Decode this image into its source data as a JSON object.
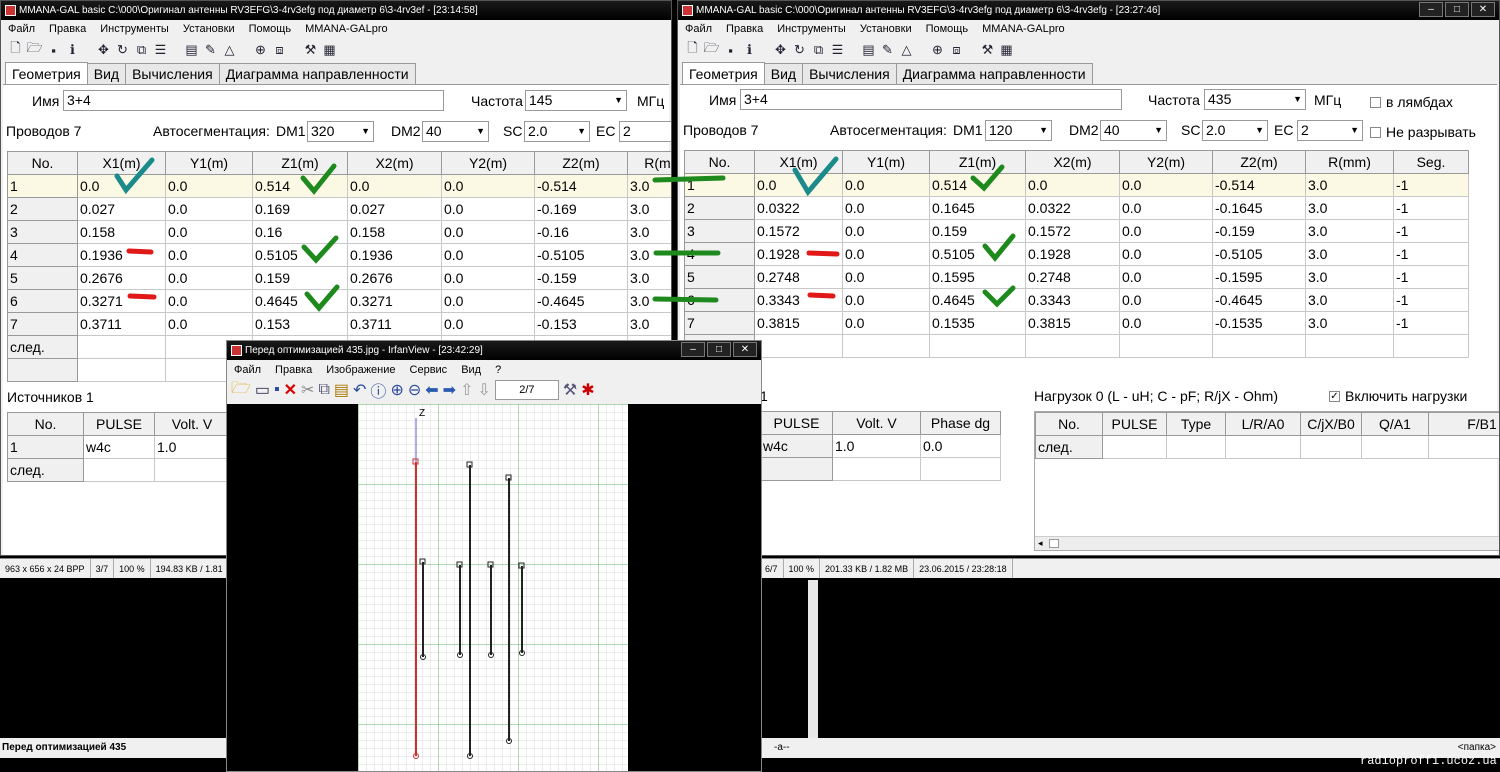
{
  "left_window": {
    "title": "MMANA-GAL basic  C:\\000\\Оригинал антенны RV3EFG\\3-4rv3efg под диаметр 6\\3-4rv3ef - [23:14:58]",
    "menu": [
      "Файл",
      "Правка",
      "Инструменты",
      "Установки",
      "Помощь",
      "MMANA-GALpro"
    ],
    "tabs": [
      "Геометрия",
      "Вид",
      "Вычисления",
      "Диаграмма направленности"
    ],
    "name_label": "Имя",
    "name_value": "3+4",
    "freq_label": "Частота",
    "freq_value": "145",
    "freq_unit": "МГц",
    "wires_label": "Проводов 7",
    "autoseg_label": "Автосегментация:",
    "dm1_label": "DM1",
    "dm1_value": "320",
    "dm2_label": "DM2",
    "dm2_value": "40",
    "sc_label": "SC",
    "sc_value": "2.0",
    "ec_label": "EC",
    "ec_value": "2",
    "columns": [
      "No.",
      "X1(m)",
      "Y1(m)",
      "Z1(m)",
      "X2(m)",
      "Y2(m)",
      "Z2(m)",
      "R(m"
    ],
    "rows": [
      [
        "1",
        "0.0",
        "0.0",
        "0.514",
        "0.0",
        "0.0",
        "-0.514",
        "3.0"
      ],
      [
        "2",
        "0.027",
        "0.0",
        "0.169",
        "0.027",
        "0.0",
        "-0.169",
        "3.0"
      ],
      [
        "3",
        "0.158",
        "0.0",
        "0.16",
        "0.158",
        "0.0",
        "-0.16",
        "3.0"
      ],
      [
        "4",
        "0.1936",
        "0.0",
        "0.5105",
        "0.1936",
        "0.0",
        "-0.5105",
        "3.0"
      ],
      [
        "5",
        "0.2676",
        "0.0",
        "0.159",
        "0.2676",
        "0.0",
        "-0.159",
        "3.0"
      ],
      [
        "6",
        "0.3271",
        "0.0",
        "0.4645",
        "0.3271",
        "0.0",
        "-0.4645",
        "3.0"
      ],
      [
        "7",
        "0.3711",
        "0.0",
        "0.153",
        "0.3711",
        "0.0",
        "-0.153",
        "3.0"
      ]
    ],
    "next_label": "след.",
    "sources_label": "Источников 1",
    "src_columns": [
      "No.",
      "PULSE",
      "Volt. V"
    ],
    "src_rows": [
      [
        "1",
        "w4c",
        "1.0"
      ]
    ],
    "status": [
      "963 x 656 x 24 BPP",
      "3/7",
      "100 %",
      "194.83 KB / 1.81"
    ],
    "caption": "Перед оптимизацией 435"
  },
  "right_window": {
    "title": "MMANA-GAL basic C:\\000\\Оригинал антенны RV3EFG\\3-4rv3efg под диаметр 6\\3-4rv3efg - [23:27:46]",
    "menu": [
      "Файл",
      "Правка",
      "Инструменты",
      "Установки",
      "Помощь",
      "MMANA-GALpro"
    ],
    "tabs": [
      "Геометрия",
      "Вид",
      "Вычисления",
      "Диаграмма направленности"
    ],
    "name_label": "Имя",
    "name_value": "3+4",
    "freq_label": "Частота",
    "freq_value": "435",
    "freq_unit": "МГц",
    "lambda_label": "в лямбдах",
    "wires_label": "Проводов 7",
    "autoseg_label": "Автосегментация:",
    "dm1_label": "DM1",
    "dm1_value": "120",
    "dm2_label": "DM2",
    "dm2_value": "40",
    "sc_label": "SC",
    "sc_value": "2.0",
    "ec_label": "EC",
    "ec_value": "2",
    "nobreak_label": "Не разрывать",
    "columns": [
      "No.",
      "X1(m)",
      "Y1(m)",
      "Z1(m)",
      "X2(m)",
      "Y2(m)",
      "Z2(m)",
      "R(mm)",
      "Seg."
    ],
    "rows": [
      [
        "1",
        "0.0",
        "0.0",
        "0.514",
        "0.0",
        "0.0",
        "-0.514",
        "3.0",
        "-1"
      ],
      [
        "2",
        "0.0322",
        "0.0",
        "0.1645",
        "0.0322",
        "0.0",
        "-0.1645",
        "3.0",
        "-1"
      ],
      [
        "3",
        "0.1572",
        "0.0",
        "0.159",
        "0.1572",
        "0.0",
        "-0.159",
        "3.0",
        "-1"
      ],
      [
        "4",
        "0.1928",
        "0.0",
        "0.5105",
        "0.1928",
        "0.0",
        "-0.5105",
        "3.0",
        "-1"
      ],
      [
        "5",
        "0.2748",
        "0.0",
        "0.1595",
        "0.2748",
        "0.0",
        "-0.1595",
        "3.0",
        "-1"
      ],
      [
        "6",
        "0.3343",
        "0.0",
        "0.4645",
        "0.3343",
        "0.0",
        "-0.4645",
        "3.0",
        "-1"
      ],
      [
        "7",
        "0.3815",
        "0.0",
        "0.1535",
        "0.3815",
        "0.0",
        "-0.1535",
        "3.0",
        "-1"
      ]
    ],
    "sources_fragment": "1",
    "src_columns": [
      "PULSE",
      "Volt. V",
      "Phase dg"
    ],
    "src_rows": [
      [
        "w4c",
        "1.0",
        "0.0"
      ]
    ],
    "loads_label": "Нагрузок 0 (L - uH; C - pF; R/jX - Ohm)",
    "loads_enable_label": "Включить нагрузки",
    "load_columns": [
      "No.",
      "PULSE",
      "Type",
      "L/R/A0",
      "C/jX/B0",
      "Q/A1",
      "F/B1"
    ],
    "next_label": "след.",
    "status": [
      "6/7",
      "100 %",
      "201.33 KB / 1.82 MB",
      "23.06.2015 / 23:28:18"
    ],
    "bottom_left": "-a--",
    "bottom_right": "<папка>"
  },
  "irfanview": {
    "title": "Перед оптимизацией 435.jpg - IrfanView - [23:42:29]",
    "menu": [
      "Файл",
      "Правка",
      "Изображение",
      "Сервис",
      "Вид",
      "?"
    ],
    "page_counter": "2/7",
    "axis_label": "Z"
  },
  "watermark": "radioproffi.ucoz.ua"
}
